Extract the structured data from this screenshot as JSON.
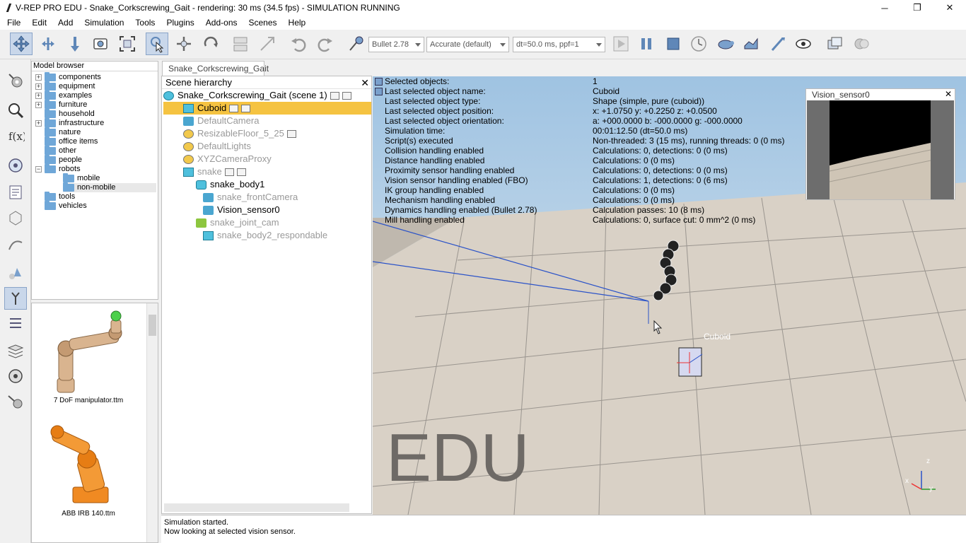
{
  "window": {
    "title": "V-REP PRO EDU - Snake_Corkscrewing_Gait - rendering: 30 ms (34.5 fps) - SIMULATION RUNNING",
    "minimize": "─",
    "restore": "❐",
    "close": "✕"
  },
  "menu": [
    "File",
    "Edit",
    "Add",
    "Simulation",
    "Tools",
    "Plugins",
    "Add-ons",
    "Scenes",
    "Help"
  ],
  "toolbar": {
    "engine": "Bullet 2.78",
    "accuracy": "Accurate (default)",
    "timestep": "dt=50.0 ms, ppf=1"
  },
  "model_browser": {
    "title": "Model browser",
    "items": [
      "components",
      "equipment",
      "examples",
      "furniture",
      "household",
      "infrastructure",
      "nature",
      "office items",
      "other",
      "people",
      "robots",
      "mobile",
      "non-mobile",
      "tools",
      "vehicles"
    ]
  },
  "thumbnails": [
    "7 DoF manipulator.ttm",
    "ABB IRB 140.ttm"
  ],
  "scene_tab": "Snake_Corkscrewing_Gait",
  "scene_hierarchy": {
    "title": "Scene hierarchy",
    "close": "✕",
    "root": "Snake_Corkscrewing_Gait (scene 1)",
    "items": [
      "Cuboid",
      "DefaultCamera",
      "ResizableFloor_5_25",
      "DefaultLights",
      "XYZCameraProxy",
      "snake",
      "snake_body1",
      "snake_frontCamera",
      "Vision_sensor0",
      "snake_joint_cam",
      "snake_body2_respondable"
    ]
  },
  "info": {
    "labels": [
      "Selected objects:",
      "Last selected object name:",
      "Last selected object type:",
      "Last selected object position:",
      "Last selected object orientation:",
      "Simulation time:",
      "Script(s) executed",
      "Collision handling enabled",
      "Distance handling enabled",
      "Proximity sensor handling enabled",
      "Vision sensor handling enabled (FBO)",
      "IK group handling enabled",
      "Mechanism handling enabled",
      "Dynamics handling enabled (Bullet 2.78)",
      "Mill handling enabled"
    ],
    "values": [
      "1",
      "Cuboid",
      "Shape (simple, pure (cuboid))",
      "x: +1.0750   y: +0.2250   z: +0.0500",
      "a: +000.0000   b: -000.0000   g: -000.0000",
      "00:01:12.50 (dt=50.0 ms)",
      "Non-threaded: 3 (15 ms), running threads: 0 (0 ms)",
      "Calculations: 0, detections: 0 (0 ms)",
      "Calculations: 0 (0 ms)",
      "Calculations: 0, detections: 0 (0 ms)",
      "Calculations: 1, detections: 0 (6 ms)",
      "Calculations: 0 (0 ms)",
      "Calculations: 0 (0 ms)",
      "Calculation passes: 10 (8 ms)",
      "Calculations: 0, surface cut: 0 mm^2 (0 ms)"
    ]
  },
  "vision_sensor": {
    "title": "Vision_sensor0",
    "close": "✕"
  },
  "viewport": {
    "watermark": "EDU",
    "object_label": "Cuboid",
    "axis_z": "z",
    "axis_x": "x",
    "axis_y": "y"
  },
  "status": {
    "line1": "Simulation started.",
    "line2": "Now looking at selected vision sensor."
  }
}
